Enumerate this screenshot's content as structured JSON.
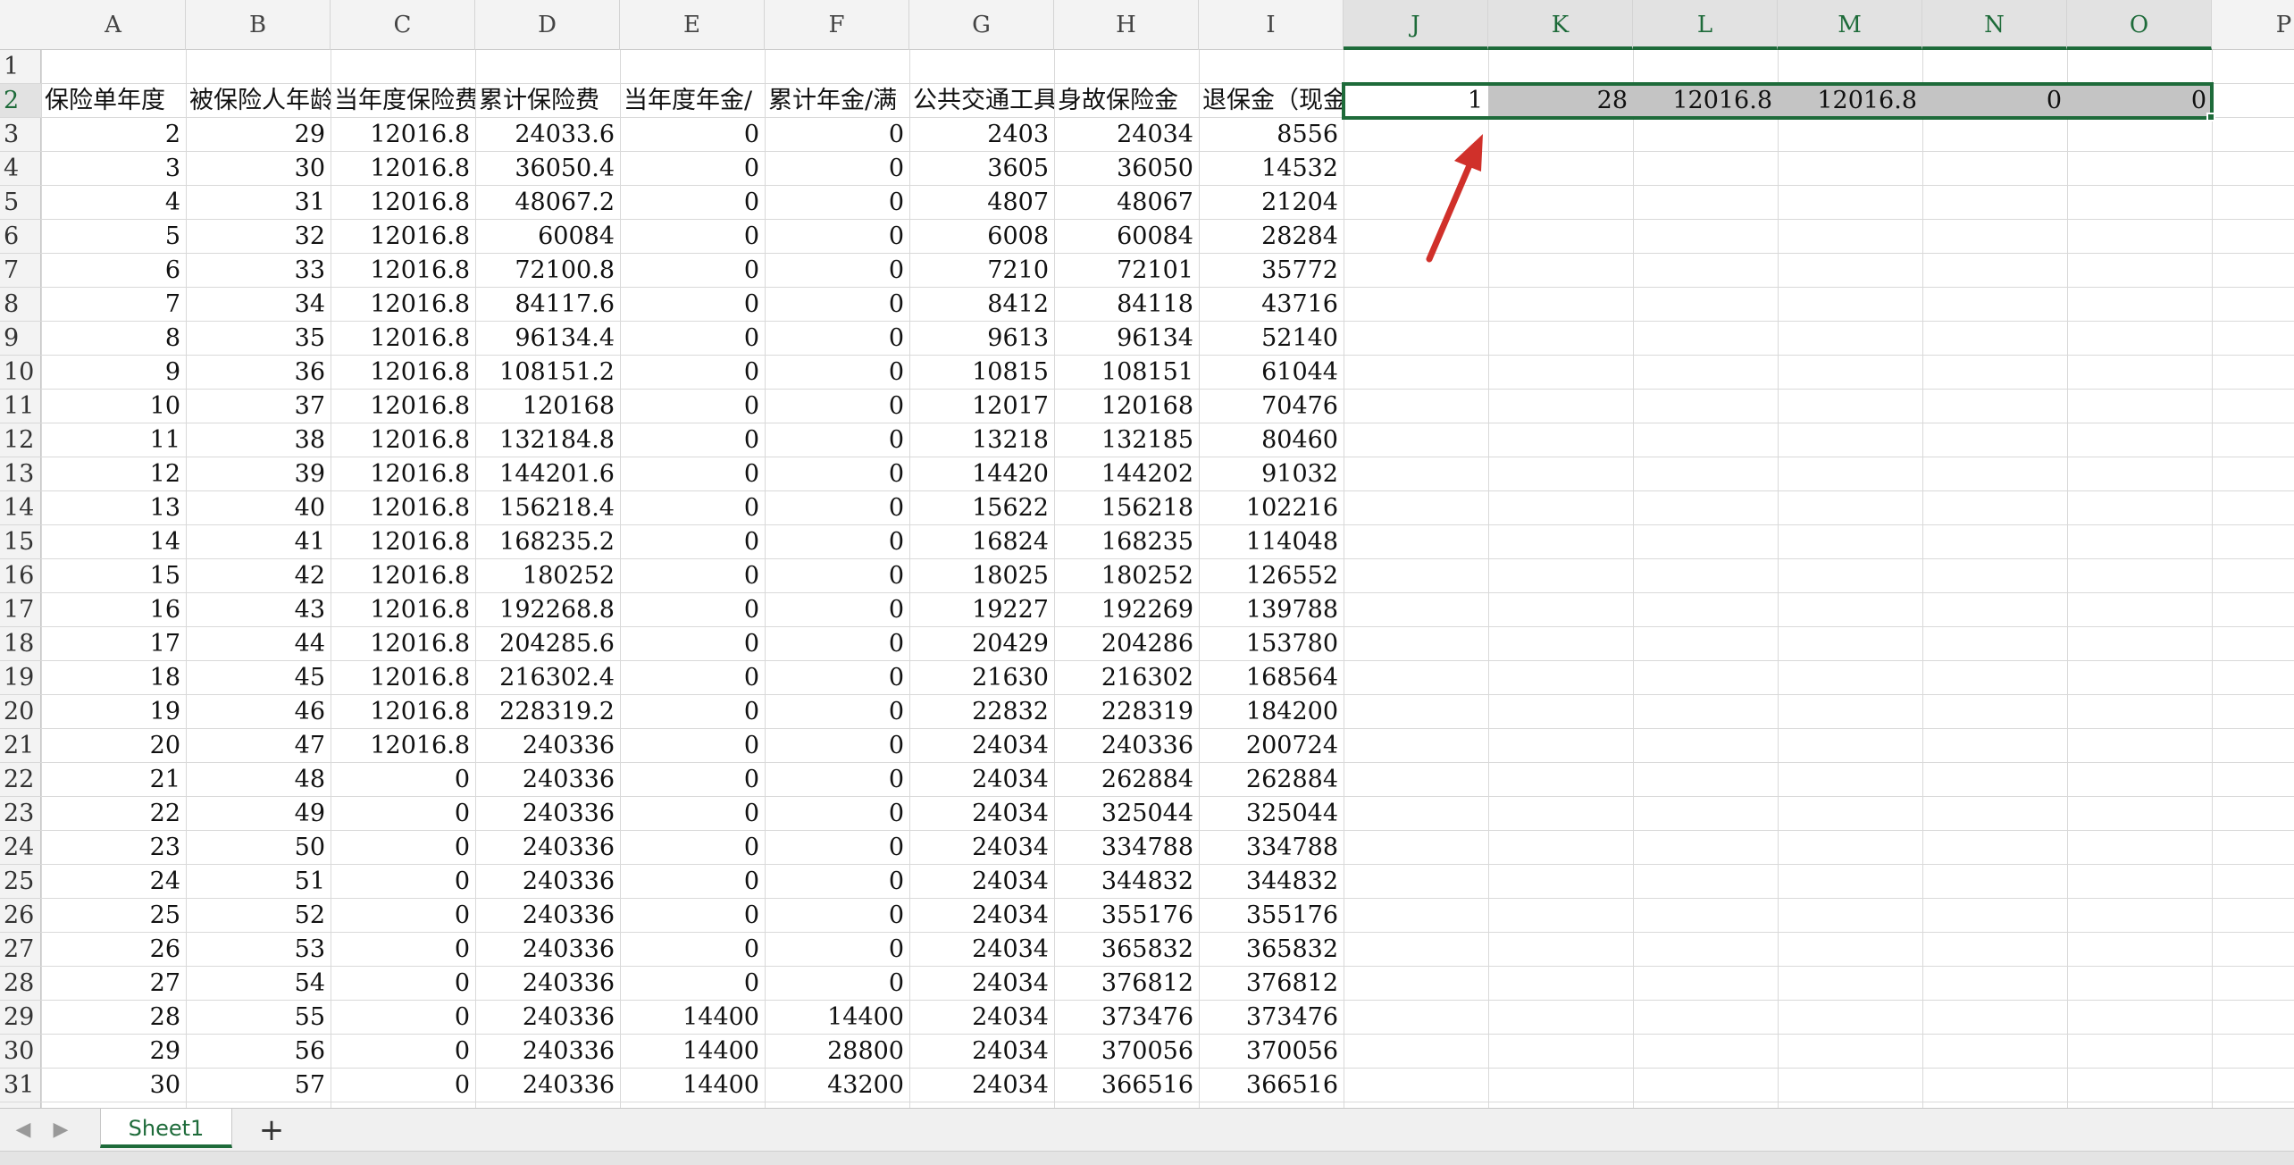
{
  "sheet": {
    "columns": [
      "A",
      "B",
      "C",
      "D",
      "E",
      "F",
      "G",
      "H",
      "I",
      "J",
      "K",
      "L",
      "M",
      "N",
      "O",
      "P"
    ],
    "rows": [
      "1",
      "2",
      "3",
      "4",
      "5",
      "6",
      "7",
      "8",
      "9",
      "10",
      "11",
      "12",
      "13",
      "14",
      "15",
      "16",
      "17",
      "18",
      "19",
      "20",
      "21",
      "22",
      "23",
      "24",
      "25",
      "26",
      "27",
      "28",
      "29",
      "30",
      "31"
    ],
    "headers": [
      "保险单年度",
      "被保险人年龄",
      "当年度保险费",
      "累计保险费",
      "当年度年金/",
      "累计年金/满",
      "公共交通工具",
      "身故保险金",
      "退保金（现金"
    ],
    "data": [
      [
        "2",
        "29",
        "12016.8",
        "24033.6",
        "0",
        "0",
        "2403",
        "24034",
        "8556"
      ],
      [
        "3",
        "30",
        "12016.8",
        "36050.4",
        "0",
        "0",
        "3605",
        "36050",
        "14532"
      ],
      [
        "4",
        "31",
        "12016.8",
        "48067.2",
        "0",
        "0",
        "4807",
        "48067",
        "21204"
      ],
      [
        "5",
        "32",
        "12016.8",
        "60084",
        "0",
        "0",
        "6008",
        "60084",
        "28284"
      ],
      [
        "6",
        "33",
        "12016.8",
        "72100.8",
        "0",
        "0",
        "7210",
        "72101",
        "35772"
      ],
      [
        "7",
        "34",
        "12016.8",
        "84117.6",
        "0",
        "0",
        "8412",
        "84118",
        "43716"
      ],
      [
        "8",
        "35",
        "12016.8",
        "96134.4",
        "0",
        "0",
        "9613",
        "96134",
        "52140"
      ],
      [
        "9",
        "36",
        "12016.8",
        "108151.2",
        "0",
        "0",
        "10815",
        "108151",
        "61044"
      ],
      [
        "10",
        "37",
        "12016.8",
        "120168",
        "0",
        "0",
        "12017",
        "120168",
        "70476"
      ],
      [
        "11",
        "38",
        "12016.8",
        "132184.8",
        "0",
        "0",
        "13218",
        "132185",
        "80460"
      ],
      [
        "12",
        "39",
        "12016.8",
        "144201.6",
        "0",
        "0",
        "14420",
        "144202",
        "91032"
      ],
      [
        "13",
        "40",
        "12016.8",
        "156218.4",
        "0",
        "0",
        "15622",
        "156218",
        "102216"
      ],
      [
        "14",
        "41",
        "12016.8",
        "168235.2",
        "0",
        "0",
        "16824",
        "168235",
        "114048"
      ],
      [
        "15",
        "42",
        "12016.8",
        "180252",
        "0",
        "0",
        "18025",
        "180252",
        "126552"
      ],
      [
        "16",
        "43",
        "12016.8",
        "192268.8",
        "0",
        "0",
        "19227",
        "192269",
        "139788"
      ],
      [
        "17",
        "44",
        "12016.8",
        "204285.6",
        "0",
        "0",
        "20429",
        "204286",
        "153780"
      ],
      [
        "18",
        "45",
        "12016.8",
        "216302.4",
        "0",
        "0",
        "21630",
        "216302",
        "168564"
      ],
      [
        "19",
        "46",
        "12016.8",
        "228319.2",
        "0",
        "0",
        "22832",
        "228319",
        "184200"
      ],
      [
        "20",
        "47",
        "12016.8",
        "240336",
        "0",
        "0",
        "24034",
        "240336",
        "200724"
      ],
      [
        "21",
        "48",
        "0",
        "240336",
        "0",
        "0",
        "24034",
        "262884",
        "262884"
      ],
      [
        "22",
        "49",
        "0",
        "240336",
        "0",
        "0",
        "24034",
        "325044",
        "325044"
      ],
      [
        "23",
        "50",
        "0",
        "240336",
        "0",
        "0",
        "24034",
        "334788",
        "334788"
      ],
      [
        "24",
        "51",
        "0",
        "240336",
        "0",
        "0",
        "24034",
        "344832",
        "344832"
      ],
      [
        "25",
        "52",
        "0",
        "240336",
        "0",
        "0",
        "24034",
        "355176",
        "355176"
      ],
      [
        "26",
        "53",
        "0",
        "240336",
        "0",
        "0",
        "24034",
        "365832",
        "365832"
      ],
      [
        "27",
        "54",
        "0",
        "240336",
        "0",
        "0",
        "24034",
        "376812",
        "376812"
      ],
      [
        "28",
        "55",
        "0",
        "240336",
        "14400",
        "14400",
        "24034",
        "373476",
        "373476"
      ],
      [
        "29",
        "56",
        "0",
        "240336",
        "14400",
        "28800",
        "24034",
        "370056",
        "370056"
      ],
      [
        "30",
        "57",
        "0",
        "240336",
        "14400",
        "43200",
        "24034",
        "366516",
        "366516"
      ]
    ],
    "selected_row": [
      "1",
      "28",
      "12016.8",
      "12016.8",
      "0",
      "0"
    ],
    "selected_columns": [
      "J",
      "K",
      "L",
      "M",
      "N",
      "O"
    ],
    "selected_row_number": "2"
  },
  "annotation": {
    "arrow_color": "#d0302a"
  },
  "tabs": {
    "sheet1_label": "Sheet1",
    "add_label": "+",
    "prev_icon": "◀",
    "next_icon": "▶"
  },
  "colors": {
    "accent": "#1e6b3a",
    "selection_fill": "#c4c4c4"
  }
}
